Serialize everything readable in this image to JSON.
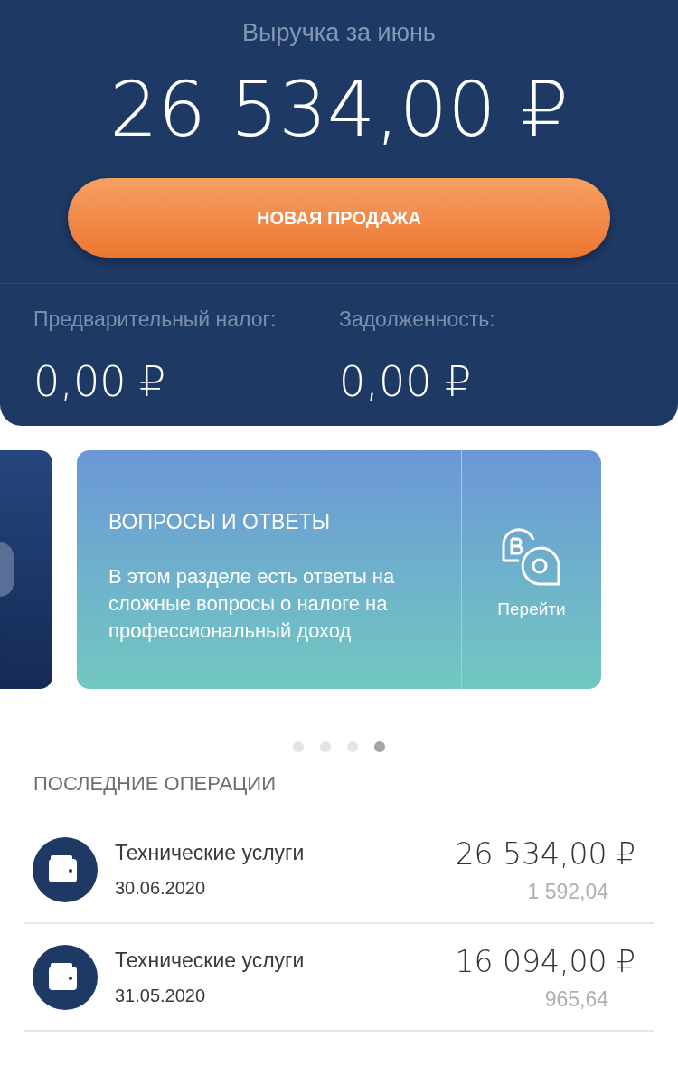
{
  "header": {
    "title": "Выручка за июнь",
    "amount": "26 534,00 ₽",
    "button": "НОВАЯ ПРОДАЖА",
    "stats": [
      {
        "label": "Предварительный налог:",
        "value": "0,00 ₽"
      },
      {
        "label": "Задолженность:",
        "value": "0,00 ₽"
      }
    ]
  },
  "card": {
    "title": "ВОПРОСЫ И ОТВЕТЫ",
    "text": "В этом разделе есть ответы на сложные вопросы о налоге на профессиональный доход",
    "link": "Перейти"
  },
  "carousel_dots": [
    {
      "selected": false
    },
    {
      "selected": false
    },
    {
      "selected": false
    },
    {
      "selected": true
    }
  ],
  "operations": {
    "title": "ПОСЛЕДНИЕ ОПЕРАЦИИ",
    "items": [
      {
        "name": "Технические услуги",
        "date": "30.06.2020",
        "amount": "26 534,00 ₽",
        "tax": "1 592,04"
      },
      {
        "name": "Технические услуги",
        "date": "31.05.2020",
        "amount": "16 094,00 ₽",
        "tax": "965,64"
      }
    ]
  }
}
